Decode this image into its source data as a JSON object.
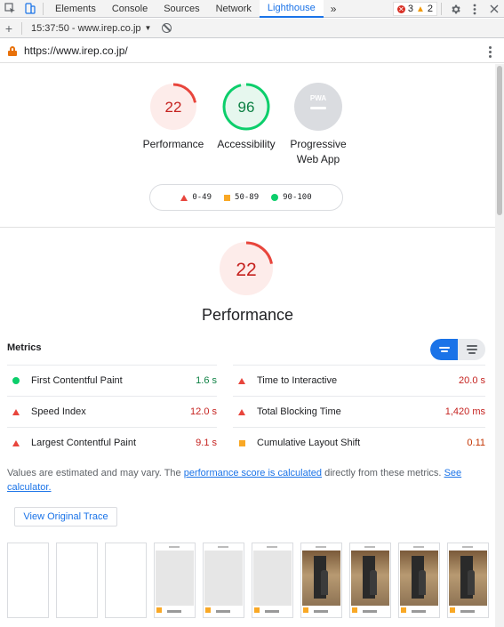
{
  "devtools": {
    "tabs": [
      {
        "label": "Elements"
      },
      {
        "label": "Console"
      },
      {
        "label": "Sources"
      },
      {
        "label": "Network"
      },
      {
        "label": "Lighthouse"
      }
    ],
    "active_tab": "Lighthouse",
    "more_tabs": "»",
    "error_count": "3",
    "warning_count": "2"
  },
  "toolbar": {
    "report_label": "15:37:50 - www.irep.co.jp",
    "dropdown_arrow": "▼"
  },
  "url_bar": {
    "url": "https://www.irep.co.jp/"
  },
  "gauges": [
    {
      "label": "Performance",
      "score": "22",
      "color": "#e8453c",
      "fraction": 0.22
    },
    {
      "label": "Accessibility",
      "score": "96",
      "color": "#0cce6b",
      "fraction": 0.96
    },
    {
      "label": "Progressive Web App",
      "badge": "PWA",
      "color": "#9aa0a6"
    }
  ],
  "legend": {
    "fail": "0-49",
    "average": "50-89",
    "pass": "90-100"
  },
  "performance": {
    "score": "22",
    "fraction": 0.22,
    "title": "Performance"
  },
  "metrics": {
    "heading": "Metrics",
    "items": [
      {
        "label": "First Contentful Paint",
        "value": "1.6 s",
        "status": "pass"
      },
      {
        "label": "Time to Interactive",
        "value": "20.0 s",
        "status": "fail"
      },
      {
        "label": "Speed Index",
        "value": "12.0 s",
        "status": "fail"
      },
      {
        "label": "Total Blocking Time",
        "value": "1,420 ms",
        "status": "fail"
      },
      {
        "label": "Largest Contentful Paint",
        "value": "9.1 s",
        "status": "fail"
      },
      {
        "label": "Cumulative Layout Shift",
        "value": "0.11",
        "status": "average"
      }
    ]
  },
  "estimate": {
    "prefix": "Values are estimated and may vary. The ",
    "link1": "performance score is calculated",
    "middle": " directly from these metrics. ",
    "link2": "See calculator."
  },
  "trace_button": "View Original Trace",
  "filmstrip_frames": [
    "blank",
    "blank",
    "blank",
    "gray",
    "gray",
    "gray",
    "photo",
    "photo",
    "photo",
    "photo"
  ],
  "colors": {
    "accent": "#1a73e8",
    "fail": "#e8453c",
    "average": "#f9a825",
    "pass": "#0cce6b"
  }
}
